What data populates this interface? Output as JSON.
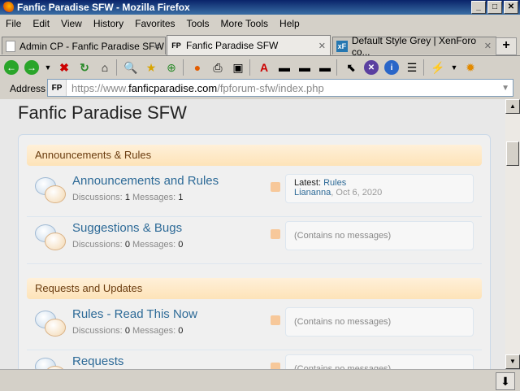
{
  "window": {
    "title": "Fanfic Paradise SFW - Mozilla Firefox"
  },
  "menu": [
    "File",
    "Edit",
    "View",
    "History",
    "Favorites",
    "Tools",
    "More Tools",
    "Help"
  ],
  "tabs": [
    {
      "label": "Admin CP - Fanfic Paradise SFW",
      "favicon": "page-icon"
    },
    {
      "label": "Fanfic Paradise SFW",
      "favicon": "FP"
    },
    {
      "label": "Default Style Grey | XenForo co...",
      "favicon": "xF"
    }
  ],
  "address": {
    "label": "Address",
    "url_prefix": "https://www.",
    "url_domain": "fanficparadise.com",
    "url_path": "/fpforum-sfw/index.php",
    "favicon": "FP"
  },
  "page": {
    "title": "Fanfic Paradise SFW",
    "categories": [
      {
        "title": "Announcements & Rules",
        "forums": [
          {
            "title": "Announcements and Rules",
            "discussions_label": "Discussions:",
            "discussions": "1",
            "messages_label": "Messages:",
            "messages": "1",
            "latest_label": "Latest:",
            "latest_thread": "Rules",
            "latest_user": "Liananna",
            "latest_date": ", Oct 6, 2020"
          },
          {
            "title": "Suggestions & Bugs",
            "discussions_label": "Discussions:",
            "discussions": "0",
            "messages_label": "Messages:",
            "messages": "0",
            "no_messages": "(Contains no messages)"
          }
        ]
      },
      {
        "title": "Requests and Updates",
        "forums": [
          {
            "title": "Rules - Read This Now",
            "discussions_label": "Discussions:",
            "discussions": "0",
            "messages_label": "Messages:",
            "messages": "0",
            "no_messages": "(Contains no messages)"
          },
          {
            "title": "Requests",
            "no_messages": "(Contains no messages)"
          }
        ]
      }
    ]
  }
}
